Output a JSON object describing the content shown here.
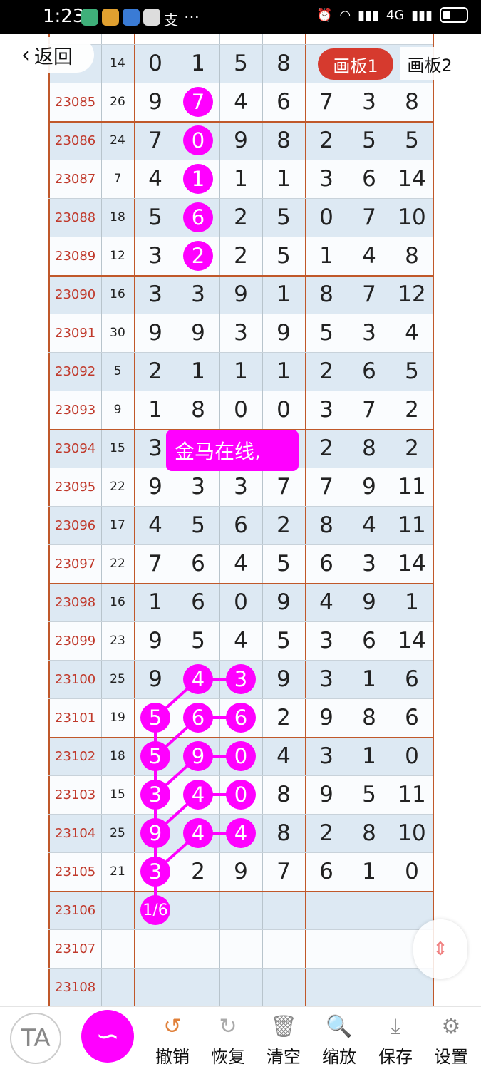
{
  "status_bar": {
    "time": "1:23",
    "more": "…",
    "network": "4G"
  },
  "header": {
    "back_label": "返回",
    "board1_label": "画板1",
    "board2_label": "画板2"
  },
  "watermark_text": "金马在线,",
  "rows": [
    {
      "issue": "",
      "sum": "14",
      "nums": [
        "0",
        "1",
        "5",
        "8",
        "",
        "",
        ""
      ]
    },
    {
      "issue": "23085",
      "sum": "26",
      "nums": [
        "9",
        "7",
        "4",
        "6",
        "7",
        "3",
        "8"
      ]
    },
    {
      "issue": "23086",
      "sum": "24",
      "nums": [
        "7",
        "0",
        "9",
        "8",
        "2",
        "5",
        "5"
      ]
    },
    {
      "issue": "23087",
      "sum": "7",
      "nums": [
        "4",
        "1",
        "1",
        "1",
        "3",
        "6",
        "14"
      ]
    },
    {
      "issue": "23088",
      "sum": "18",
      "nums": [
        "5",
        "6",
        "2",
        "5",
        "0",
        "7",
        "10"
      ]
    },
    {
      "issue": "23089",
      "sum": "12",
      "nums": [
        "3",
        "2",
        "2",
        "5",
        "1",
        "4",
        "8"
      ]
    },
    {
      "issue": "23090",
      "sum": "16",
      "nums": [
        "3",
        "3",
        "9",
        "1",
        "8",
        "7",
        "12"
      ]
    },
    {
      "issue": "23091",
      "sum": "30",
      "nums": [
        "9",
        "9",
        "3",
        "9",
        "5",
        "3",
        "4"
      ]
    },
    {
      "issue": "23092",
      "sum": "5",
      "nums": [
        "2",
        "1",
        "1",
        "1",
        "2",
        "6",
        "5"
      ]
    },
    {
      "issue": "23093",
      "sum": "9",
      "nums": [
        "1",
        "8",
        "0",
        "0",
        "3",
        "7",
        "2"
      ]
    },
    {
      "issue": "23094",
      "sum": "15",
      "nums": [
        "3",
        "",
        "",
        "",
        "2",
        "8",
        "2"
      ]
    },
    {
      "issue": "23095",
      "sum": "22",
      "nums": [
        "9",
        "3",
        "3",
        "7",
        "7",
        "9",
        "11"
      ]
    },
    {
      "issue": "23096",
      "sum": "17",
      "nums": [
        "4",
        "5",
        "6",
        "2",
        "8",
        "4",
        "11"
      ]
    },
    {
      "issue": "23097",
      "sum": "22",
      "nums": [
        "7",
        "6",
        "4",
        "5",
        "6",
        "3",
        "14"
      ]
    },
    {
      "issue": "23098",
      "sum": "16",
      "nums": [
        "1",
        "6",
        "0",
        "9",
        "4",
        "9",
        "1"
      ]
    },
    {
      "issue": "23099",
      "sum": "23",
      "nums": [
        "9",
        "5",
        "4",
        "5",
        "3",
        "6",
        "14"
      ]
    },
    {
      "issue": "23100",
      "sum": "25",
      "nums": [
        "9",
        "4",
        "3",
        "9",
        "3",
        "1",
        "6"
      ]
    },
    {
      "issue": "23101",
      "sum": "19",
      "nums": [
        "5",
        "6",
        "6",
        "2",
        "9",
        "8",
        "6"
      ]
    },
    {
      "issue": "23102",
      "sum": "18",
      "nums": [
        "5",
        "9",
        "0",
        "4",
        "3",
        "1",
        "0"
      ]
    },
    {
      "issue": "23103",
      "sum": "15",
      "nums": [
        "3",
        "4",
        "0",
        "8",
        "9",
        "5",
        "11"
      ]
    },
    {
      "issue": "23104",
      "sum": "25",
      "nums": [
        "9",
        "4",
        "4",
        "8",
        "2",
        "8",
        "10"
      ]
    },
    {
      "issue": "23105",
      "sum": "21",
      "nums": [
        "3",
        "2",
        "9",
        "7",
        "6",
        "1",
        "0"
      ]
    },
    {
      "issue": "23106",
      "sum": "",
      "nums": [
        "1/6",
        "",
        "",
        "",
        "",
        "",
        ""
      ]
    },
    {
      "issue": "23107",
      "sum": "",
      "nums": [
        "",
        "",
        "",
        "",
        "",
        "",
        ""
      ]
    },
    {
      "issue": "23108",
      "sum": "",
      "nums": [
        "",
        "",
        "",
        "",
        "",
        "",
        ""
      ]
    }
  ],
  "highlight_color": "#ff00ff",
  "toolbar": {
    "ta_label": "TA",
    "items": [
      {
        "label": "撤销",
        "icon": "undo-icon"
      },
      {
        "label": "恢复",
        "icon": "redo-icon"
      },
      {
        "label": "清空",
        "icon": "trash-icon"
      },
      {
        "label": "缩放",
        "icon": "zoom-icon"
      },
      {
        "label": "保存",
        "icon": "download-icon"
      },
      {
        "label": "设置",
        "icon": "gear-icon"
      }
    ]
  }
}
